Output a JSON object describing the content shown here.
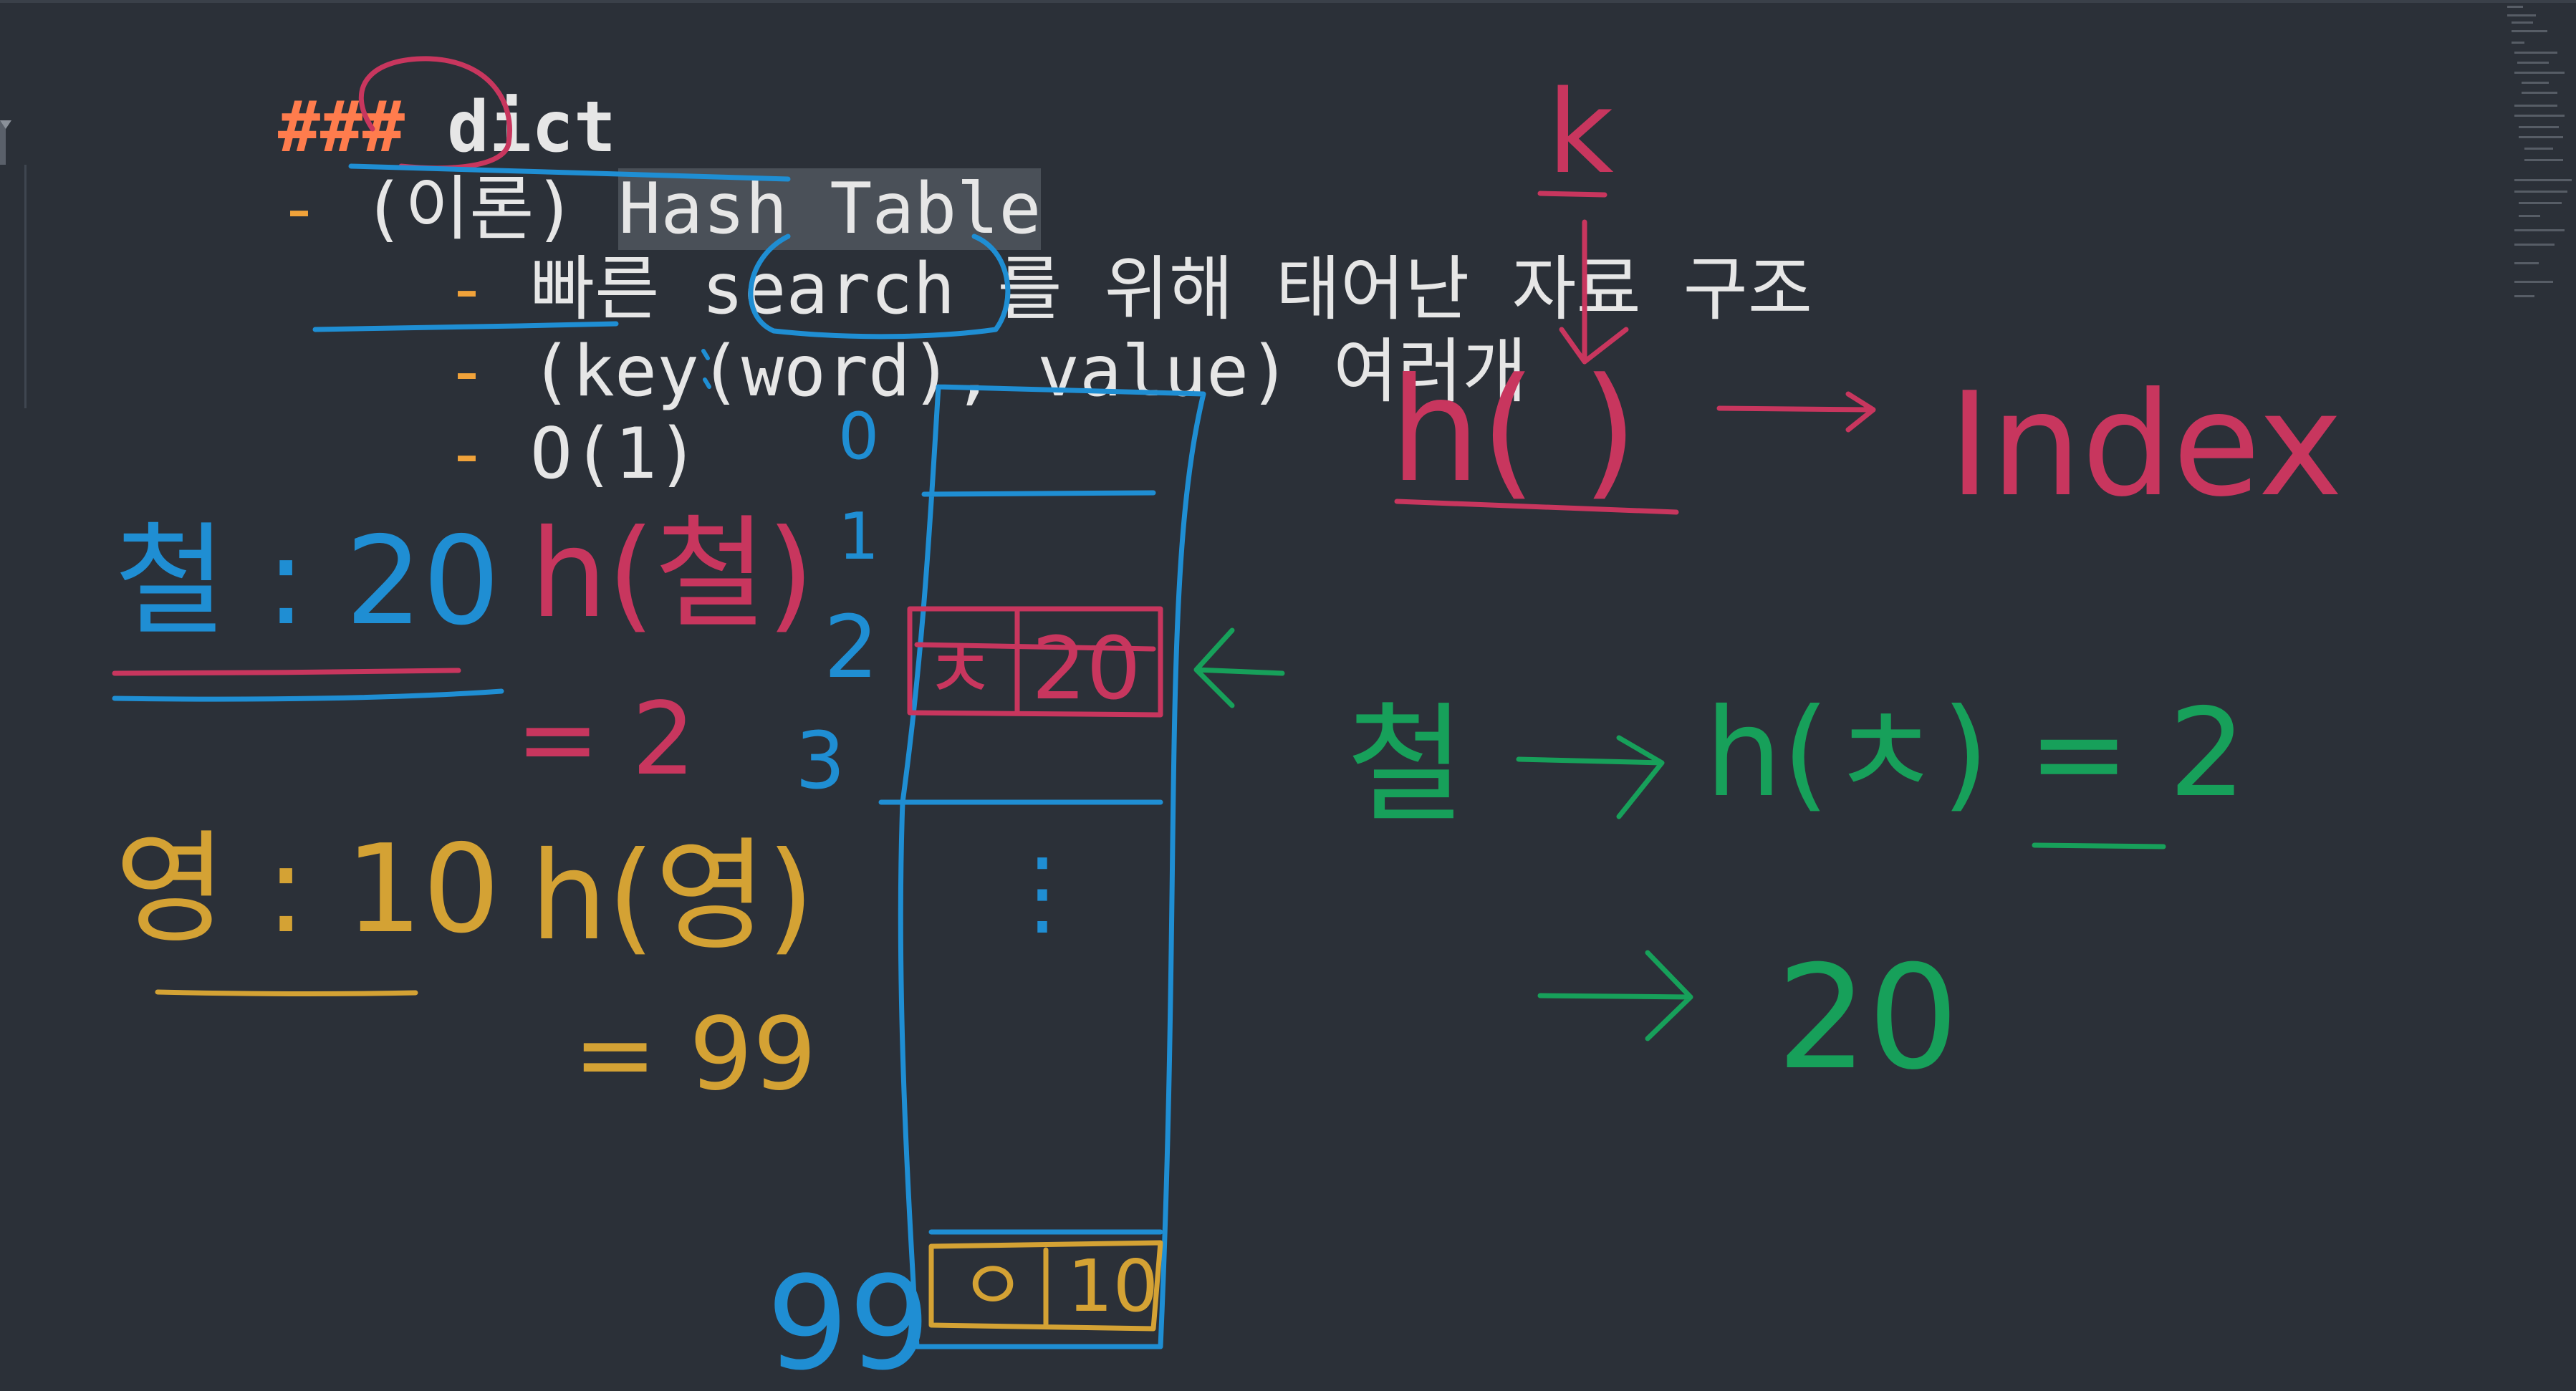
{
  "editor": {
    "heading_marks": "###",
    "heading_text": "dict",
    "item1_prefix": "(이론) ",
    "item1_selected": "Hash Table",
    "sub_items": [
      "빠른 search 를 위해 태어난 자료 구조",
      "(key(word), value) 여러개",
      "O(1)"
    ],
    "bullet": "-"
  },
  "ink_colors": {
    "red": "#c8365e",
    "blue": "#1f8ed3",
    "yellow": "#d4a234",
    "green": "#17a05a"
  },
  "annotations": {
    "k_label": "k",
    "index_label": "Index",
    "h_fn": "h( )",
    "row_labels": [
      "0",
      "1",
      "2",
      "3",
      "99"
    ],
    "vdots": "⋮",
    "row2_key": "ㅊ",
    "row2_value": "20",
    "row99_key": "ㅇ",
    "row99_value": "10",
    "left_entry1": "철 : 20",
    "left_entry1_hash": "h(철)",
    "left_entry1_result": "= 2",
    "left_entry2": "영 : 10",
    "left_entry2_hash": "h(영)",
    "left_entry2_result": "= 99",
    "green_key": "철",
    "green_hash": "h(ㅊ) = 2",
    "green_value": "20"
  }
}
